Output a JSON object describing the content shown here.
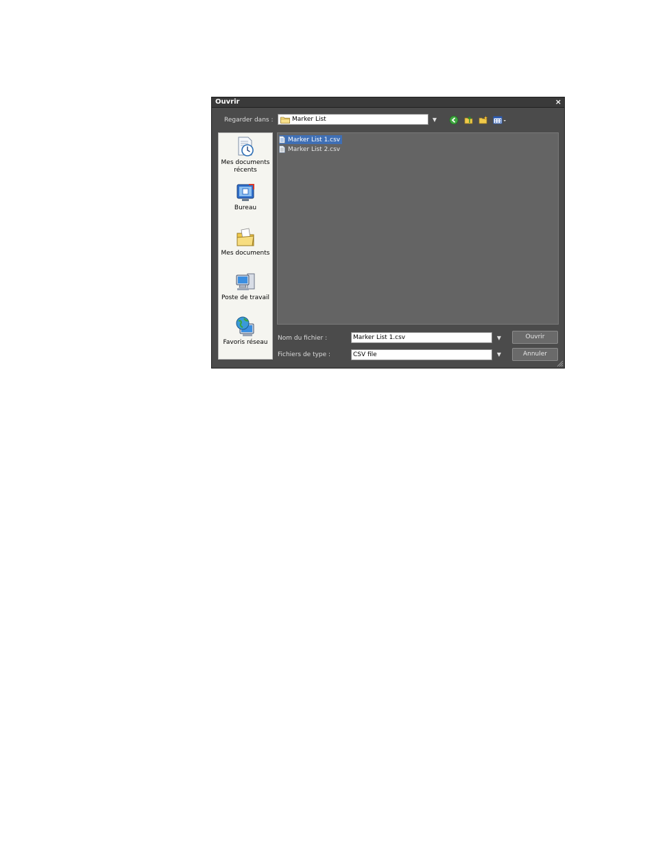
{
  "dialog": {
    "title": "Ouvrir",
    "close_label": "×",
    "look_in_label": "Regarder dans :",
    "look_in_value": "Marker List",
    "toolbar_icons": [
      "back-icon",
      "up-folder-icon",
      "new-folder-icon",
      "view-menu-icon"
    ]
  },
  "places": [
    {
      "label": "Mes documents récents",
      "icon": "recent-documents-icon"
    },
    {
      "label": "Bureau",
      "icon": "desktop-icon"
    },
    {
      "label": "Mes documents",
      "icon": "my-documents-icon"
    },
    {
      "label": "Poste de travail",
      "icon": "my-computer-icon"
    },
    {
      "label": "Favoris réseau",
      "icon": "network-places-icon"
    }
  ],
  "files": [
    {
      "name": "Marker List 1.csv",
      "selected": true
    },
    {
      "name": "Marker List 2.csv",
      "selected": false
    }
  ],
  "filename": {
    "label": "Nom du fichier :",
    "value": "Marker List 1.csv"
  },
  "filetype": {
    "label": "Fichiers de type :",
    "value": "CSV file"
  },
  "buttons": {
    "open": "Ouvrir",
    "cancel": "Annuler"
  },
  "colors": {
    "selection": "#3f6fb5",
    "dialog_bg": "#4b4b4b",
    "list_bg": "#646464"
  }
}
